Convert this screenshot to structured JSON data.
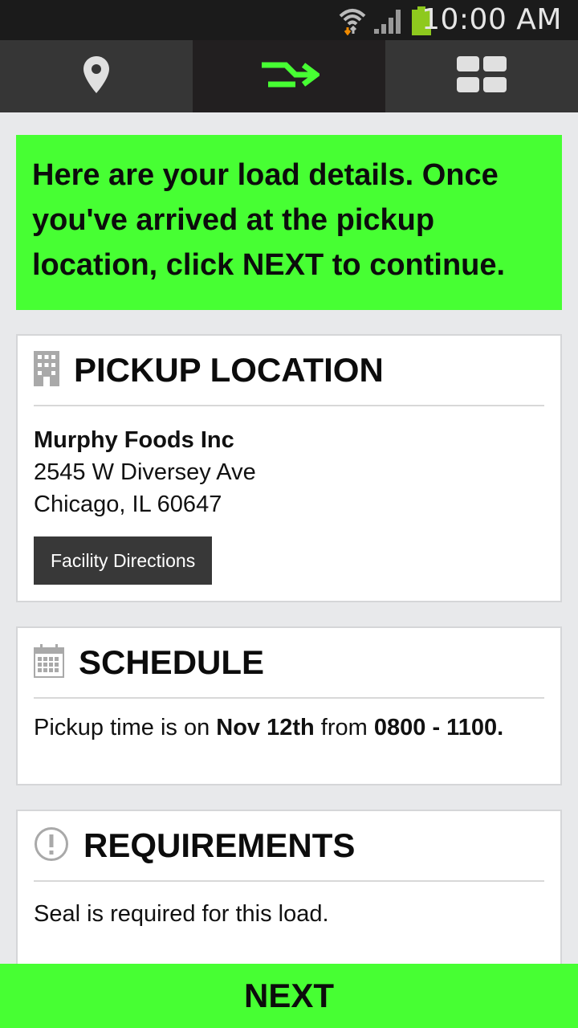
{
  "status_bar": {
    "time": "10:00 AM",
    "icons": [
      "wifi-icon",
      "signal-icon",
      "battery-icon"
    ]
  },
  "tabs": [
    {
      "name": "location",
      "icon": "map-pin-icon",
      "active": false
    },
    {
      "name": "route",
      "icon": "arrow-right-icon",
      "active": true
    },
    {
      "name": "grid",
      "icon": "grid-icon",
      "active": false
    }
  ],
  "banner": {
    "text": "Here are your load details. Once you've arrived at the pickup location, click NEXT to continue."
  },
  "pickup": {
    "title": "PICKUP LOCATION",
    "company": "Murphy Foods Inc",
    "address_line1": "2545 W Diversey Ave",
    "address_line2": "Chicago, IL 60647",
    "directions_button": "Facility Directions"
  },
  "schedule": {
    "title": "SCHEDULE",
    "text_prefix": "Pickup time is on ",
    "date": "Nov 12th",
    "text_middle": " from ",
    "time_range": "0800 - 1100."
  },
  "requirements": {
    "title": "REQUIREMENTS",
    "text": "Seal is required for this load."
  },
  "next_button": "NEXT",
  "colors": {
    "accent": "#47ff33",
    "status_bar": "#1b1b1b",
    "tab_bar": "#363636",
    "tab_active": "#221f20"
  }
}
